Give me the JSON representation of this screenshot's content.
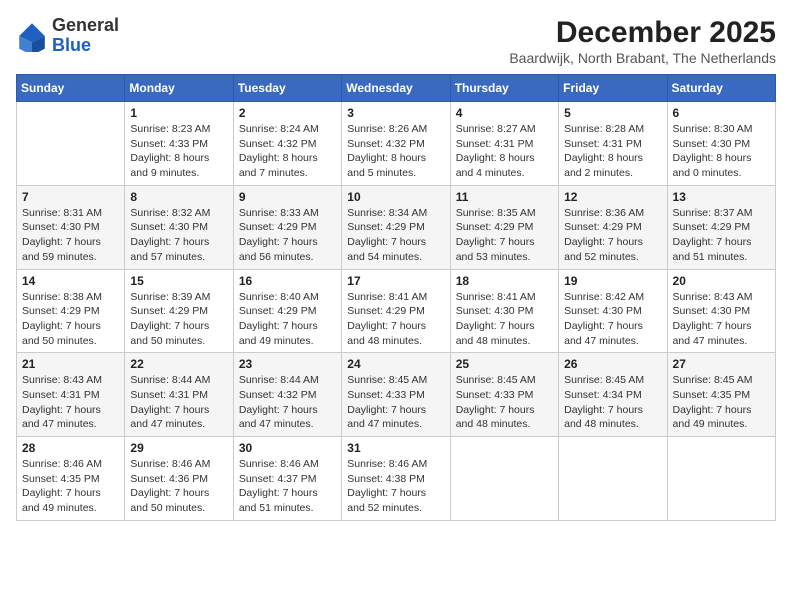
{
  "logo": {
    "general": "General",
    "blue": "Blue"
  },
  "header": {
    "month": "December 2025",
    "location": "Baardwijk, North Brabant, The Netherlands"
  },
  "weekdays": [
    "Sunday",
    "Monday",
    "Tuesday",
    "Wednesday",
    "Thursday",
    "Friday",
    "Saturday"
  ],
  "weeks": [
    [
      {
        "day": "",
        "info": ""
      },
      {
        "day": "1",
        "info": "Sunrise: 8:23 AM\nSunset: 4:33 PM\nDaylight: 8 hours\nand 9 minutes."
      },
      {
        "day": "2",
        "info": "Sunrise: 8:24 AM\nSunset: 4:32 PM\nDaylight: 8 hours\nand 7 minutes."
      },
      {
        "day": "3",
        "info": "Sunrise: 8:26 AM\nSunset: 4:32 PM\nDaylight: 8 hours\nand 5 minutes."
      },
      {
        "day": "4",
        "info": "Sunrise: 8:27 AM\nSunset: 4:31 PM\nDaylight: 8 hours\nand 4 minutes."
      },
      {
        "day": "5",
        "info": "Sunrise: 8:28 AM\nSunset: 4:31 PM\nDaylight: 8 hours\nand 2 minutes."
      },
      {
        "day": "6",
        "info": "Sunrise: 8:30 AM\nSunset: 4:30 PM\nDaylight: 8 hours\nand 0 minutes."
      }
    ],
    [
      {
        "day": "7",
        "info": "Sunrise: 8:31 AM\nSunset: 4:30 PM\nDaylight: 7 hours\nand 59 minutes."
      },
      {
        "day": "8",
        "info": "Sunrise: 8:32 AM\nSunset: 4:30 PM\nDaylight: 7 hours\nand 57 minutes."
      },
      {
        "day": "9",
        "info": "Sunrise: 8:33 AM\nSunset: 4:29 PM\nDaylight: 7 hours\nand 56 minutes."
      },
      {
        "day": "10",
        "info": "Sunrise: 8:34 AM\nSunset: 4:29 PM\nDaylight: 7 hours\nand 54 minutes."
      },
      {
        "day": "11",
        "info": "Sunrise: 8:35 AM\nSunset: 4:29 PM\nDaylight: 7 hours\nand 53 minutes."
      },
      {
        "day": "12",
        "info": "Sunrise: 8:36 AM\nSunset: 4:29 PM\nDaylight: 7 hours\nand 52 minutes."
      },
      {
        "day": "13",
        "info": "Sunrise: 8:37 AM\nSunset: 4:29 PM\nDaylight: 7 hours\nand 51 minutes."
      }
    ],
    [
      {
        "day": "14",
        "info": "Sunrise: 8:38 AM\nSunset: 4:29 PM\nDaylight: 7 hours\nand 50 minutes."
      },
      {
        "day": "15",
        "info": "Sunrise: 8:39 AM\nSunset: 4:29 PM\nDaylight: 7 hours\nand 50 minutes."
      },
      {
        "day": "16",
        "info": "Sunrise: 8:40 AM\nSunset: 4:29 PM\nDaylight: 7 hours\nand 49 minutes."
      },
      {
        "day": "17",
        "info": "Sunrise: 8:41 AM\nSunset: 4:29 PM\nDaylight: 7 hours\nand 48 minutes."
      },
      {
        "day": "18",
        "info": "Sunrise: 8:41 AM\nSunset: 4:30 PM\nDaylight: 7 hours\nand 48 minutes."
      },
      {
        "day": "19",
        "info": "Sunrise: 8:42 AM\nSunset: 4:30 PM\nDaylight: 7 hours\nand 47 minutes."
      },
      {
        "day": "20",
        "info": "Sunrise: 8:43 AM\nSunset: 4:30 PM\nDaylight: 7 hours\nand 47 minutes."
      }
    ],
    [
      {
        "day": "21",
        "info": "Sunrise: 8:43 AM\nSunset: 4:31 PM\nDaylight: 7 hours\nand 47 minutes."
      },
      {
        "day": "22",
        "info": "Sunrise: 8:44 AM\nSunset: 4:31 PM\nDaylight: 7 hours\nand 47 minutes."
      },
      {
        "day": "23",
        "info": "Sunrise: 8:44 AM\nSunset: 4:32 PM\nDaylight: 7 hours\nand 47 minutes."
      },
      {
        "day": "24",
        "info": "Sunrise: 8:45 AM\nSunset: 4:33 PM\nDaylight: 7 hours\nand 47 minutes."
      },
      {
        "day": "25",
        "info": "Sunrise: 8:45 AM\nSunset: 4:33 PM\nDaylight: 7 hours\nand 48 minutes."
      },
      {
        "day": "26",
        "info": "Sunrise: 8:45 AM\nSunset: 4:34 PM\nDaylight: 7 hours\nand 48 minutes."
      },
      {
        "day": "27",
        "info": "Sunrise: 8:45 AM\nSunset: 4:35 PM\nDaylight: 7 hours\nand 49 minutes."
      }
    ],
    [
      {
        "day": "28",
        "info": "Sunrise: 8:46 AM\nSunset: 4:35 PM\nDaylight: 7 hours\nand 49 minutes."
      },
      {
        "day": "29",
        "info": "Sunrise: 8:46 AM\nSunset: 4:36 PM\nDaylight: 7 hours\nand 50 minutes."
      },
      {
        "day": "30",
        "info": "Sunrise: 8:46 AM\nSunset: 4:37 PM\nDaylight: 7 hours\nand 51 minutes."
      },
      {
        "day": "31",
        "info": "Sunrise: 8:46 AM\nSunset: 4:38 PM\nDaylight: 7 hours\nand 52 minutes."
      },
      {
        "day": "",
        "info": ""
      },
      {
        "day": "",
        "info": ""
      },
      {
        "day": "",
        "info": ""
      }
    ]
  ]
}
